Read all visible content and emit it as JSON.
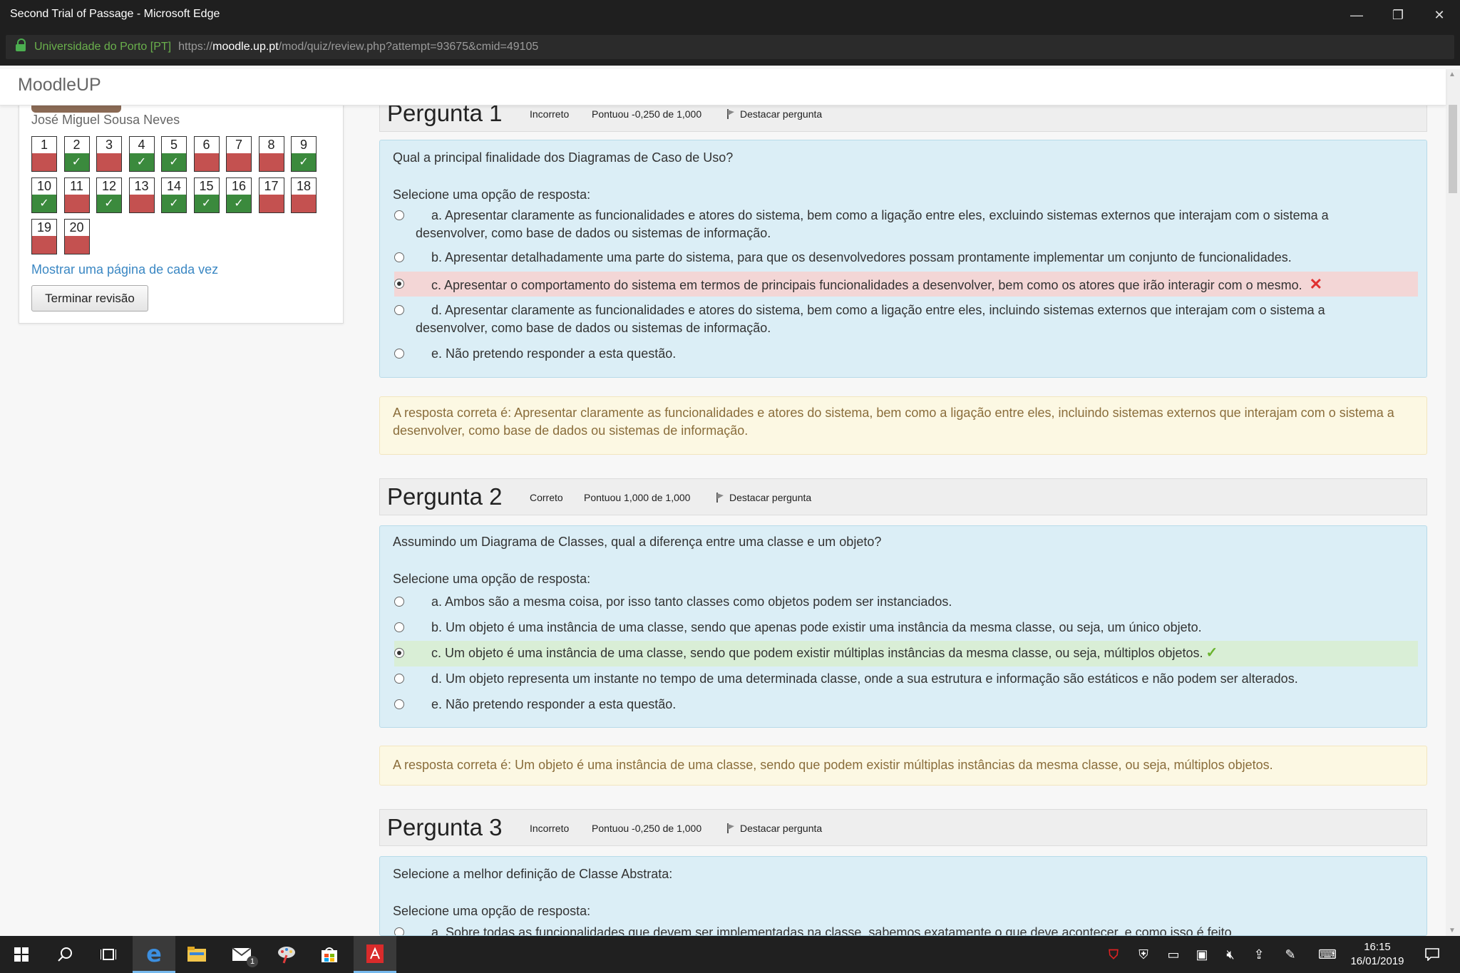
{
  "window": {
    "title": "Second Trial of Passage - Microsoft Edge",
    "minimize_glyph": "—",
    "restore_glyph": "❐",
    "close_glyph": "✕"
  },
  "address": {
    "site_identity": "Universidade do Porto [PT]",
    "url_prefix": "https://",
    "url_host": "moodle.up.pt",
    "url_path": "/mod/quiz/review.php?attempt=93675&cmid=49105"
  },
  "header": {
    "brand": "MoodleUP"
  },
  "sidebar": {
    "username": "José Miguel Sousa Neves",
    "show_one_page": "Mostrar uma página de cada vez",
    "finish_review": "Terminar revisão",
    "questions": [
      {
        "n": "1",
        "state": "incorrect"
      },
      {
        "n": "2",
        "state": "correct"
      },
      {
        "n": "3",
        "state": "incorrect"
      },
      {
        "n": "4",
        "state": "correct"
      },
      {
        "n": "5",
        "state": "correct"
      },
      {
        "n": "6",
        "state": "incorrect"
      },
      {
        "n": "7",
        "state": "incorrect"
      },
      {
        "n": "8",
        "state": "incorrect"
      },
      {
        "n": "9",
        "state": "correct"
      },
      {
        "n": "10",
        "state": "correct"
      },
      {
        "n": "11",
        "state": "incorrect"
      },
      {
        "n": "12",
        "state": "correct"
      },
      {
        "n": "13",
        "state": "incorrect"
      },
      {
        "n": "14",
        "state": "correct"
      },
      {
        "n": "15",
        "state": "correct"
      },
      {
        "n": "16",
        "state": "correct"
      },
      {
        "n": "17",
        "state": "incorrect"
      },
      {
        "n": "18",
        "state": "incorrect"
      },
      {
        "n": "19",
        "state": "incorrect"
      },
      {
        "n": "20",
        "state": "incorrect"
      }
    ]
  },
  "questions": [
    {
      "title": "Pergunta 1",
      "status": "Incorreto",
      "grade": "Pontuou -0,250 de 1,000",
      "flag": "Destacar pergunta",
      "text": "Qual a principal finalidade dos Diagramas de Caso de Uso?",
      "prompt": "Selecione uma opção de resposta:",
      "options": [
        {
          "line1": "a. Apresentar claramente as funcionalidades e atores do sistema, bem como a ligação entre eles, excluindo sistemas externos que interajam com o sistema a",
          "line2": "desenvolver, como base de dados ou sistemas de informação."
        },
        {
          "line1": "b. Apresentar detalhadamente uma parte do sistema, para que os desenvolvedores possam prontamente implementar um conjunto de funcionalidades.",
          "line2": ""
        },
        {
          "line1": "c. Apresentar o comportamento do sistema em termos de principais funcionalidades a desenvolver, bem como os atores que irão interagir com o mesmo.",
          "line2": ""
        },
        {
          "line1": "d. Apresentar claramente as funcionalidades e atores do sistema, bem como a ligação entre eles, incluindo sistemas externos que interajam com o sistema a",
          "line2": "desenvolver, como base de dados ou sistemas de informação."
        },
        {
          "line1": "e. Não pretendo responder a esta questão.",
          "line2": ""
        }
      ],
      "feedback": "A resposta correta é: Apresentar claramente as funcionalidades e atores do sistema, bem como a ligação entre eles, incluindo sistemas externos que interajam com o sistema a desenvolver, como base de dados ou sistemas de informação."
    },
    {
      "title": "Pergunta 2",
      "status": "Correto",
      "grade": "Pontuou 1,000 de 1,000",
      "flag": "Destacar pergunta",
      "text": "Assumindo um Diagrama de Classes, qual a diferença entre uma classe e um objeto?",
      "prompt": "Selecione uma opção de resposta:",
      "options": [
        {
          "line1": "a. Ambos são a mesma coisa, por isso tanto classes como objetos podem ser instanciados."
        },
        {
          "line1": "b. Um objeto é uma instância de uma classe, sendo que apenas pode existir uma instância da mesma classe, ou seja, um único objeto."
        },
        {
          "line1": "c. Um objeto é uma instância de uma classe, sendo que podem existir múltiplas instâncias da mesma classe, ou seja, múltiplos objetos."
        },
        {
          "line1": "d. Um objeto representa um instante no tempo de uma determinada classe, onde a sua estrutura e informação são estáticos e não podem ser alterados."
        },
        {
          "line1": "e. Não pretendo responder a esta questão."
        }
      ],
      "feedback": "A resposta correta é: Um objeto é uma instância de uma classe, sendo que podem existir múltiplas instâncias da mesma classe, ou seja, múltiplos objetos."
    },
    {
      "title": "Pergunta 3",
      "status": "Incorreto",
      "grade": "Pontuou -0,250 de 1,000",
      "flag": "Destacar pergunta",
      "text": "Selecione a melhor definição de Classe Abstrata:",
      "prompt": "Selecione uma opção de resposta:",
      "options": [
        {
          "line1": "a. Sobre todas as funcionalidades que devem ser implementadas na classe, sabemos exatamente o que deve acontecer, e como isso é feito."
        }
      ]
    }
  ],
  "taskbar": {
    "mail_badge": "1",
    "time": "16:15",
    "date": "16/01/2019"
  },
  "colors": {
    "incorrect": "#c45150",
    "correct": "#3b8a3d",
    "question_bg": "#dbeef6",
    "feedback_bg": "#fcf8e3",
    "link": "#3a87c3"
  }
}
